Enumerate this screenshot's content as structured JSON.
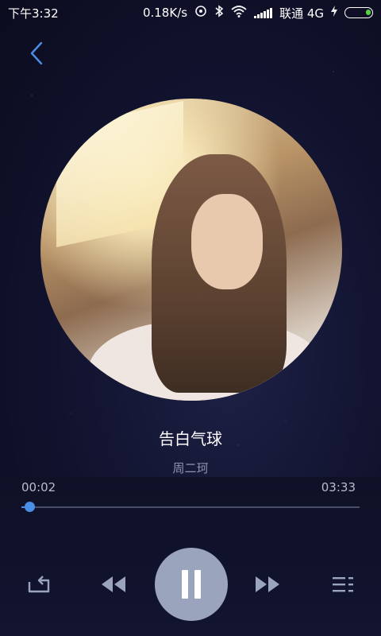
{
  "status_bar": {
    "time": "下午3:32",
    "network_speed": "0.18K/s",
    "carrier": "联通 4G",
    "icons": [
      "hotspot-icon",
      "bluetooth-icon",
      "wifi-icon",
      "signal-icon",
      "charging-icon",
      "battery-icon"
    ]
  },
  "track": {
    "title": "告白气球",
    "artist": "周二珂"
  },
  "progress": {
    "current_time": "00:02",
    "total_time": "03:33",
    "fraction": 0.01
  },
  "controls": {
    "repeat": "repeat-icon",
    "previous": "rewind-icon",
    "play_state": "pause-icon",
    "next": "fast-forward-icon",
    "playlist": "playlist-icon"
  },
  "colors": {
    "accent": "#4a8ee6",
    "play_button": "#9aa5bd",
    "battery": "#56d23c"
  }
}
